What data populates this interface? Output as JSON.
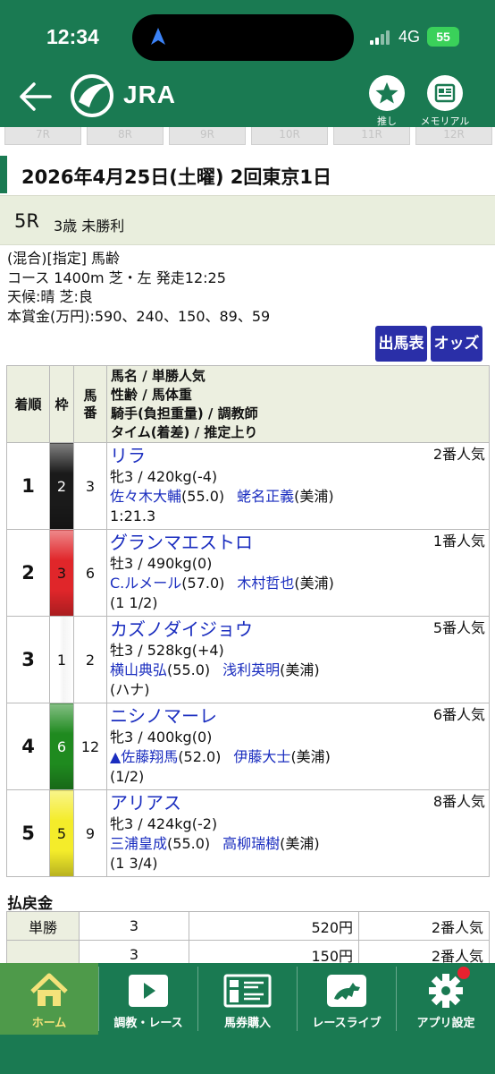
{
  "status_bar": {
    "time": "12:34",
    "network": "4G",
    "battery": "55"
  },
  "header": {
    "logo_text": "JRA",
    "oshi_label": "推し",
    "memorial_label": "メモリアル"
  },
  "race_tabs": [
    "7R",
    "8R",
    "9R",
    "10R",
    "11R",
    "12R"
  ],
  "race": {
    "date_line": "2026年4月25日(土曜) 2回東京1日",
    "number": "5R",
    "name": "3歳 未勝利",
    "conditions": "(混合)[指定] 馬齢",
    "course": "コース 1400m 芝・左 発走12:25",
    "weather": "天候:晴 芝:良",
    "prize": "本賞金(万円):590、240、150、89、59"
  },
  "buttons": {
    "entries": "出馬表",
    "odds": "オッズ"
  },
  "table": {
    "headers": {
      "pos": "着順",
      "waku": "枠",
      "num": "馬番",
      "info_lines": [
        "馬名 / 単勝人気",
        "性齢 / 馬体重",
        "騎手(負担重量) / 調教師",
        "タイム(着差) / 推定上り"
      ]
    },
    "rows": [
      {
        "pos": "1",
        "waku": "2",
        "waku_color": "#1a1a1a",
        "waku_text_color": "#ffffff",
        "num": "3",
        "horse": "リラ",
        "popularity": "2番人気",
        "sex_age_weight": "牝3 / 420kg(-4)",
        "jockey": "佐々木大輔",
        "jockey_weight": "(55.0)",
        "trainer": "蛯名正義",
        "stable": "(美浦)",
        "time": "1:21.3"
      },
      {
        "pos": "2",
        "waku": "3",
        "waku_color": "#e0262a",
        "waku_text_color": "#111111",
        "num": "6",
        "horse": "グランマエストロ",
        "popularity": "1番人気",
        "sex_age_weight": "牡3 / 490kg(0)",
        "jockey": "C.ルメール",
        "jockey_weight": "(57.0)",
        "trainer": "木村哲也",
        "stable": "(美浦)",
        "time": "(1 1/2)"
      },
      {
        "pos": "3",
        "waku": "1",
        "waku_color": "#ffffff",
        "waku_text_color": "#111111",
        "num": "2",
        "horse": "カズノダイジョウ",
        "popularity": "5番人気",
        "sex_age_weight": "牡3 / 528kg(+4)",
        "jockey": "横山典弘",
        "jockey_weight": "(55.0)",
        "trainer": "浅利英明",
        "stable": "(美浦)",
        "time": "(ハナ)"
      },
      {
        "pos": "4",
        "waku": "6",
        "waku_color": "#1f8a1f",
        "waku_text_color": "#ffffff",
        "num": "12",
        "horse": "ニシノマーレ",
        "popularity": "6番人気",
        "sex_age_weight": "牝3 / 400kg(0)",
        "jockey": "▲佐藤翔馬",
        "jockey_weight": "(52.0)",
        "trainer": "伊藤大士",
        "stable": "(美浦)",
        "time": "(1/2)"
      },
      {
        "pos": "5",
        "waku": "5",
        "waku_color": "#f4ec2a",
        "waku_text_color": "#111111",
        "num": "9",
        "horse": "アリアス",
        "popularity": "8番人気",
        "sex_age_weight": "牝3 / 424kg(-2)",
        "jockey": "三浦皇成",
        "jockey_weight": "(55.0)",
        "trainer": "高柳瑞樹",
        "stable": "(美浦)",
        "time": "(1 3/4)"
      }
    ]
  },
  "payout": {
    "title": "払戻金",
    "rows": [
      {
        "type": "単勝",
        "num": "3",
        "amount": "520円",
        "popularity": "2番人気"
      },
      {
        "type": "",
        "num": "3",
        "amount": "150円",
        "popularity": "2番人気"
      }
    ]
  },
  "bottom_nav": [
    {
      "label": "ホーム",
      "icon": "home-icon"
    },
    {
      "label": "調教・レース",
      "icon": "play-icon"
    },
    {
      "label": "馬券購入",
      "icon": "ticket-icon"
    },
    {
      "label": "レースライブ",
      "icon": "horse-icon"
    },
    {
      "label": "アプリ設定",
      "icon": "gear-icon"
    }
  ],
  "colors": {
    "brand_green": "#1a7a52",
    "link_blue": "#1a2dbf",
    "button_blue": "#2a2fa8",
    "active_tab": "#4e9a4a"
  }
}
